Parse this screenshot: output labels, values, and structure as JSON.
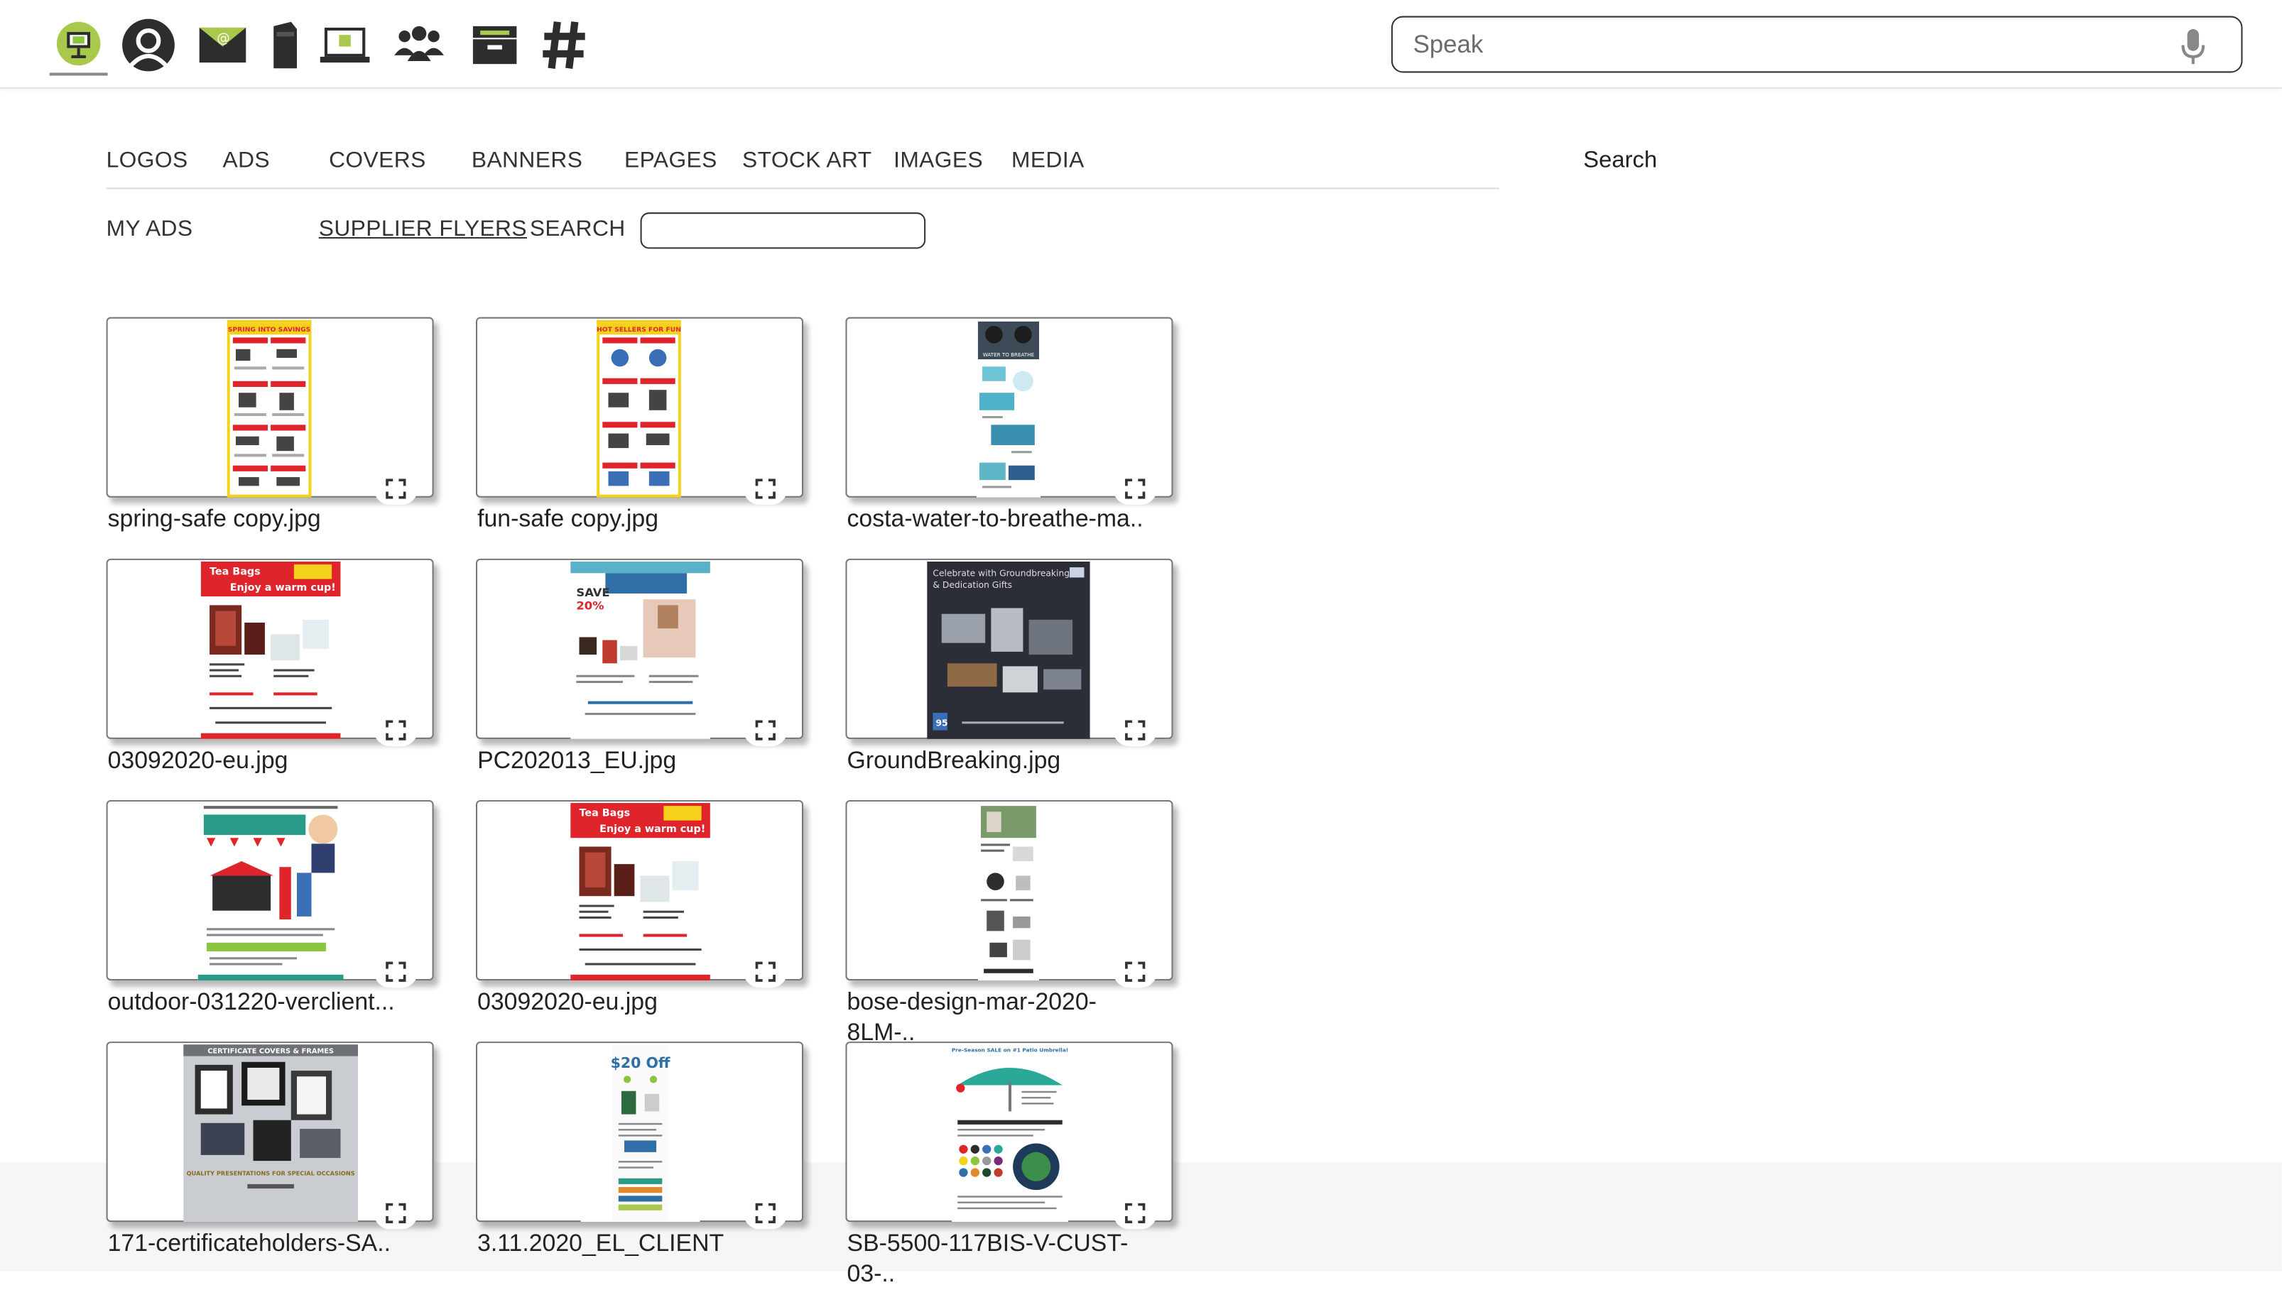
{
  "speak_placeholder": "Speak",
  "nav_tabs": [
    "LOGOS",
    "ADS",
    "COVERS",
    "BANNERS",
    "EPAGES",
    "STOCK ART",
    "IMAGES",
    "MEDIA"
  ],
  "search_label": "Search",
  "subnav": {
    "my_ads": "MY ADS",
    "supplier_flyers": "SUPPLIER FLYERS",
    "search": "SEARCH"
  },
  "thumbnails": {
    "t1_title": "SPRING INTO SAVINGS",
    "t2_title": "HOT SELLERS FOR FUN",
    "t3_title": "WATER TO BREATHE",
    "t4_line1": "Tea Bags",
    "t4_line2": "Enjoy a warm cup!",
    "t5_line1": "SAVE",
    "t5_line2": "20%",
    "t6_line1": "Celebrate with Groundbreaking",
    "t6_line2": "& Dedication Gifts",
    "t9_line1": "CERTIFICATE COVERS & FRAMES",
    "t9_line2": "QUALITY PRESENTATIONS FOR SPECIAL OCCASIONS",
    "t10_line1": "$20 Off",
    "t11_line1": "Pre-Season SALE on #1 Patio Umbrella!"
  },
  "files": [
    {
      "name": "spring-safe copy.jpg"
    },
    {
      "name": "fun-safe copy.jpg"
    },
    {
      "name": "costa-water-to-breathe-ma.."
    },
    {
      "name": "03092020-eu.jpg"
    },
    {
      "name": "PC202013_EU.jpg"
    },
    {
      "name": "GroundBreaking.jpg"
    },
    {
      "name": "outdoor-031220-verclient..."
    },
    {
      "name": "03092020-eu.jpg"
    },
    {
      "name": "bose-design-mar-2020-8LM-.."
    },
    {
      "name": "171-certificateholders-SA.."
    },
    {
      "name": "3.11.2020_EL_CLIENT"
    },
    {
      "name": "SB-5500-117BIS-V-CUST-03-.."
    }
  ],
  "colors": {
    "flyer_red": "#e0242c",
    "flyer_yellow": "#f4d21c",
    "dark": "#2d2d2d",
    "accent_green": "#8cc63f"
  }
}
